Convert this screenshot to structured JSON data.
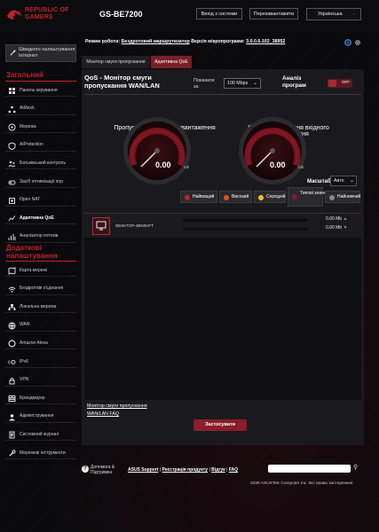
{
  "header": {
    "brand_line1": "REPUBLIC OF",
    "brand_line2": "GAMERS",
    "model": "GS-BE7200",
    "logout_label": "Вихід з системи",
    "reboot_label": "Перезавантажити",
    "language": "Українська"
  },
  "status": {
    "mode_label": "Режим роботи:",
    "mode_value": "Бездротовий маршрутизатор",
    "firmware_label": "Версія мікропрограми:",
    "firmware_value": "3.0.0.6.102_38952"
  },
  "sidebar": {
    "quick_setup": "Швидкого налаштування Інтернет",
    "general_title": "Загальний",
    "general_items": [
      {
        "label": "Панель керування",
        "icon": "dashboard-icon"
      },
      {
        "label": "AiMesh",
        "icon": "aimesh-icon"
      },
      {
        "label": "Мережа",
        "icon": "network-icon"
      },
      {
        "label": "AiProtection",
        "icon": "shield-icon"
      },
      {
        "label": "Батьківський контроль",
        "icon": "parental-icon"
      },
      {
        "label": "Засіб оптимізації ігор",
        "icon": "gamepad-icon"
      },
      {
        "label": "Open NAT",
        "icon": "nat-icon"
      },
      {
        "label": "Адаптивна QoE",
        "icon": "qos-icon"
      },
      {
        "label": "Аналізатор потоків",
        "icon": "traffic-icon"
      }
    ],
    "advanced_title_line1": "Додаткові",
    "advanced_title_line2": "налаштування",
    "advanced_items": [
      {
        "label": "Карта мережі",
        "icon": "map-icon"
      },
      {
        "label": "Бездротові з'єднання",
        "icon": "wireless-icon"
      },
      {
        "label": "Локальна мережа",
        "icon": "lan-icon"
      },
      {
        "label": "WAN",
        "icon": "globe-icon"
      },
      {
        "label": "Amazon Alexa",
        "icon": "alexa-icon"
      },
      {
        "label": "IPv6",
        "icon": "ipv6-icon"
      },
      {
        "label": "VPN",
        "icon": "vpn-icon"
      },
      {
        "label": "Брандмауер",
        "icon": "firewall-icon"
      },
      {
        "label": "Адміністрування",
        "icon": "admin-icon"
      },
      {
        "label": "Системний журнал",
        "icon": "log-icon"
      },
      {
        "label": "Мережеві інструменти",
        "icon": "tools-icon"
      }
    ]
  },
  "tabs": {
    "monitor": "Монітор смуги пропускання",
    "adaptive": "Адаптивна QoE"
  },
  "panel": {
    "title": "QoS - Монітор смуги пропускання WAN/LAN",
    "show_label": "Показати за",
    "speed_option": "100 Mbps",
    "analysis_label": "Аналіз програм",
    "toggle_state": "OFF",
    "upload_title": "Пропускна здатність вивантаження",
    "download_title": "Смуга пропускання вхідного завантаження",
    "upload_value": "0.00",
    "download_value": "0.00",
    "gauge_unit": "Mb",
    "scale_label": "Масштаб",
    "scale_value": "Авто",
    "priorities": [
      {
        "label": "Найвищий",
        "color": "#c4202a"
      },
      {
        "label": "Високий",
        "color": "#e0501a"
      },
      {
        "label": "Середній",
        "color": "#f0c020"
      },
      {
        "label": "Типові значення",
        "color": "#7a1f27"
      },
      {
        "label": "Найнижчий",
        "color": "#888888"
      }
    ],
    "device_name": "DESKTOP-4BN0HFT",
    "device_up": "0.00 Mb",
    "device_down": "0.00 Mb",
    "link1": "Монітор смуги пропускання",
    "link2": "WAN/LAN FAQ",
    "apply": "Застосувати"
  },
  "footer": {
    "help": "Допомога & Підтримка",
    "support": "ASUS Support",
    "register": "Реєстрація продукту",
    "feedback": "Відгук",
    "faq": "FAQ",
    "copyright": "2026 ASUSTeK Computer Inc. Всі права застережені."
  },
  "colors": {
    "accent": "#c4202a",
    "active_tab": "#7a1f27",
    "panel_bg": "#1a1a1d"
  }
}
